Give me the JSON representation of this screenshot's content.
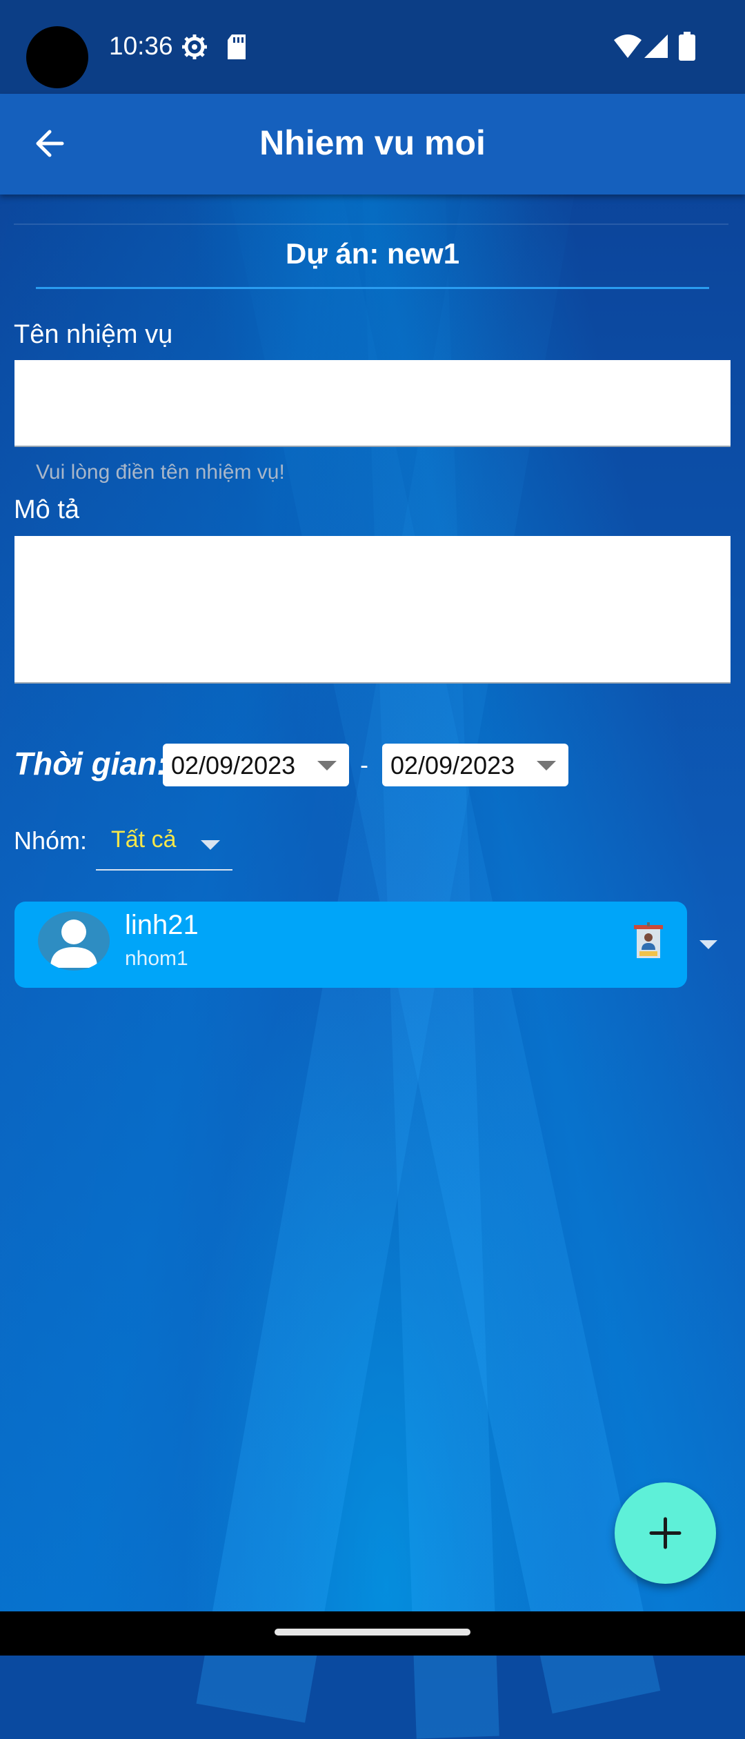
{
  "status_bar": {
    "time": "10:36",
    "icons": [
      "settings-gear-icon",
      "sd-card-icon",
      "wifi-icon",
      "signal-icon",
      "battery-icon"
    ]
  },
  "app_bar": {
    "title": "Nhiem vu moi",
    "back_icon": "arrow-left-icon"
  },
  "project": {
    "label": "Dự án: new1"
  },
  "form": {
    "task_name_label": "Tên nhiệm vụ",
    "task_name_value": "",
    "task_name_hint": "Vui lòng điền tên nhiệm vụ!",
    "description_label": "Mô tả",
    "description_value": ""
  },
  "time_range": {
    "label": "Thời gian:",
    "start_date": "02/09/2023",
    "separator": "-",
    "end_date": "02/09/2023"
  },
  "group_filter": {
    "label": "Nhóm:",
    "selected": "Tất cả"
  },
  "members": [
    {
      "username": "linh21",
      "group": "nhom1",
      "badge_icon": "staff-badge-icon"
    }
  ],
  "fab": {
    "icon": "plus-icon"
  },
  "colors": {
    "app_bar": "#1560bd",
    "card": "#00a5f9",
    "fab": "#5ef0d8",
    "group_text": "#f5e64a"
  }
}
